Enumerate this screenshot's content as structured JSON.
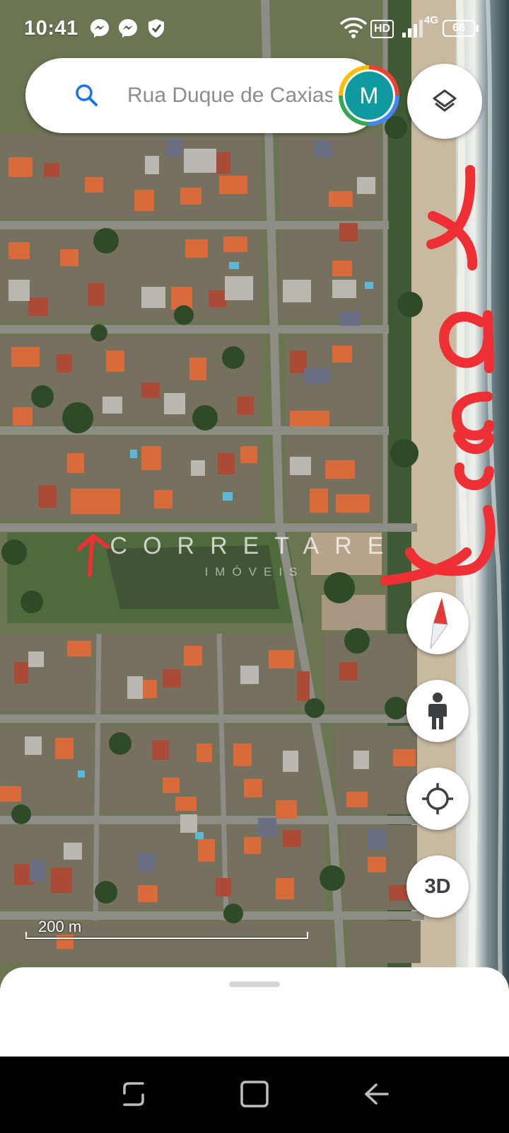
{
  "status_bar": {
    "time": "10:41",
    "hd_label": "HD",
    "network_label": "4G",
    "battery_level": "66",
    "icons": [
      "messenger-icon",
      "messenger-icon",
      "shield-icon",
      "wifi-icon",
      "signal-icon",
      "battery-icon"
    ]
  },
  "search": {
    "text": "Rua Duque de Caxias",
    "avatar_letter": "M"
  },
  "map": {
    "watermark_brand": "CORRETARE",
    "watermark_sub": "IMÓVEIS",
    "handwritten_annotation": "mar",
    "scale_label": "200 m"
  },
  "controls": {
    "layers": "layers-icon",
    "compass": "compass-icon",
    "street_view": "street-view-pegman-icon",
    "my_location": "my-location-icon",
    "view_3d_label": "3D"
  },
  "colors": {
    "map_green": "#5e6a49",
    "roof_orange": "#d96a3a",
    "annotation_red": "#ee2f33",
    "avatar_teal": "#0f9aa0",
    "google_blue": "#1a73e8"
  }
}
